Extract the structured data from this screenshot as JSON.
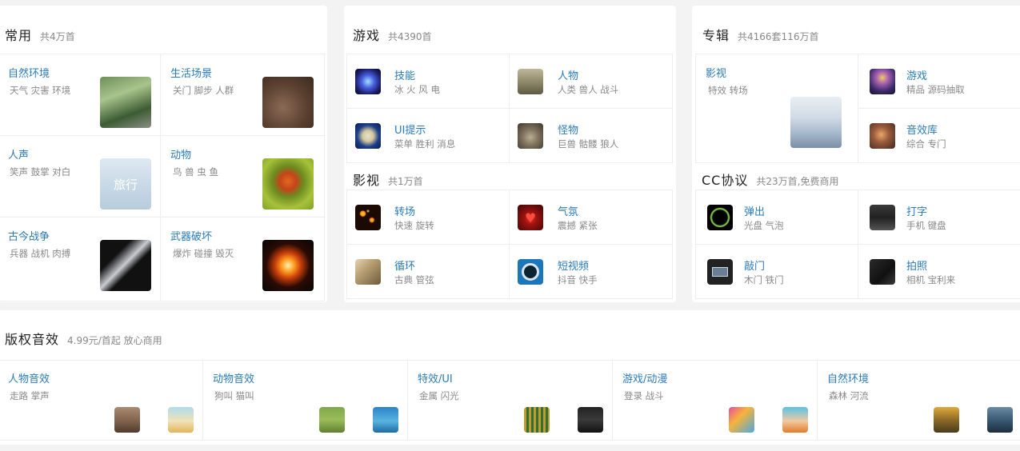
{
  "common": {
    "title": "常用",
    "subtitle": "共4万首",
    "items": [
      {
        "title": "自然环境",
        "sub": "天气 灾害 环境",
        "icon": "forest-thumb"
      },
      {
        "title": "生活场景",
        "sub": "关门 脚步 人群",
        "icon": "footprints-thumb"
      },
      {
        "title": "人声",
        "sub": "笑声 鼓掌 对白",
        "icon": "sky-thumb",
        "thumb_text": "旅行"
      },
      {
        "title": "动物",
        "sub": "鸟 兽 虫 鱼",
        "icon": "ladybug-thumb"
      },
      {
        "title": "古今战争",
        "sub": "兵器 战机 肉搏",
        "icon": "blade-thumb"
      },
      {
        "title": "武器破坏",
        "sub": "爆炸 碰撞 毁灭",
        "icon": "explosion-thumb"
      }
    ]
  },
  "game": {
    "title": "游戏",
    "subtitle": "共4390首",
    "items": [
      {
        "title": "技能",
        "sub": "冰 火 风 电",
        "icon": "skill-thumb"
      },
      {
        "title": "人物",
        "sub": "人类 兽人 战斗",
        "icon": "warrior-thumb"
      },
      {
        "title": "UI提示",
        "sub": "菜单 胜利 消息",
        "icon": "ui-thumb"
      },
      {
        "title": "怪物",
        "sub": "巨兽 骷髅 狼人",
        "icon": "monster-thumb"
      }
    ]
  },
  "film": {
    "title": "影视",
    "subtitle": "共1万首",
    "items": [
      {
        "title": "转场",
        "sub": "快速 旋转",
        "icon": "sparks-thumb"
      },
      {
        "title": "气氛",
        "sub": "震撼 紧张",
        "icon": "heart-thumb"
      },
      {
        "title": "循环",
        "sub": "古典 管弦",
        "icon": "loop-thumb"
      },
      {
        "title": "短视频",
        "sub": "抖音 快手",
        "icon": "short-video-thumb"
      }
    ]
  },
  "album": {
    "title": "专辑",
    "subtitle": "共4166套116万首",
    "feature": {
      "title": "影视",
      "sub": "特效 转场",
      "icon": "film-album-thumb"
    },
    "items": [
      {
        "title": "游戏",
        "sub": "精品 源码抽取",
        "icon": "game-album-thumb"
      },
      {
        "title": "音效库",
        "sub": "综合 专门",
        "icon": "sfx-library-thumb"
      }
    ]
  },
  "cc": {
    "title": "CC协议",
    "subtitle": "共23万首,免费商用",
    "items": [
      {
        "title": "弹出",
        "sub": "光盘 气泡",
        "icon": "popup-thumb"
      },
      {
        "title": "打字",
        "sub": "手机 键盘",
        "icon": "keyboard-thumb"
      },
      {
        "title": "敲门",
        "sub": "木门 铁门",
        "icon": "door-thumb"
      },
      {
        "title": "拍照",
        "sub": "相机 宝利来",
        "icon": "camera-thumb"
      }
    ]
  },
  "paid": {
    "title": "版权音效",
    "subtitle": "4.99元/首起 放心商用",
    "items": [
      {
        "title": "人物音效",
        "sub": "走路 掌声",
        "icons": [
          "walking-thumb",
          "kid-thumb"
        ]
      },
      {
        "title": "动物音效",
        "sub": "狗叫 猫叫",
        "icons": [
          "dog-thumb",
          "dolphin-thumb"
        ]
      },
      {
        "title": "特效/UI",
        "sub": "金属 闪光",
        "icons": [
          "chip-thumb",
          "radio-thumb"
        ]
      },
      {
        "title": "游戏/动漫",
        "sub": "登录 战斗",
        "icons": [
          "cartoon-thumb",
          "boy-thumb"
        ]
      },
      {
        "title": "自然环境",
        "sub": "森林 河流",
        "icons": [
          "forest-thumb",
          "river-thumb"
        ]
      }
    ]
  }
}
